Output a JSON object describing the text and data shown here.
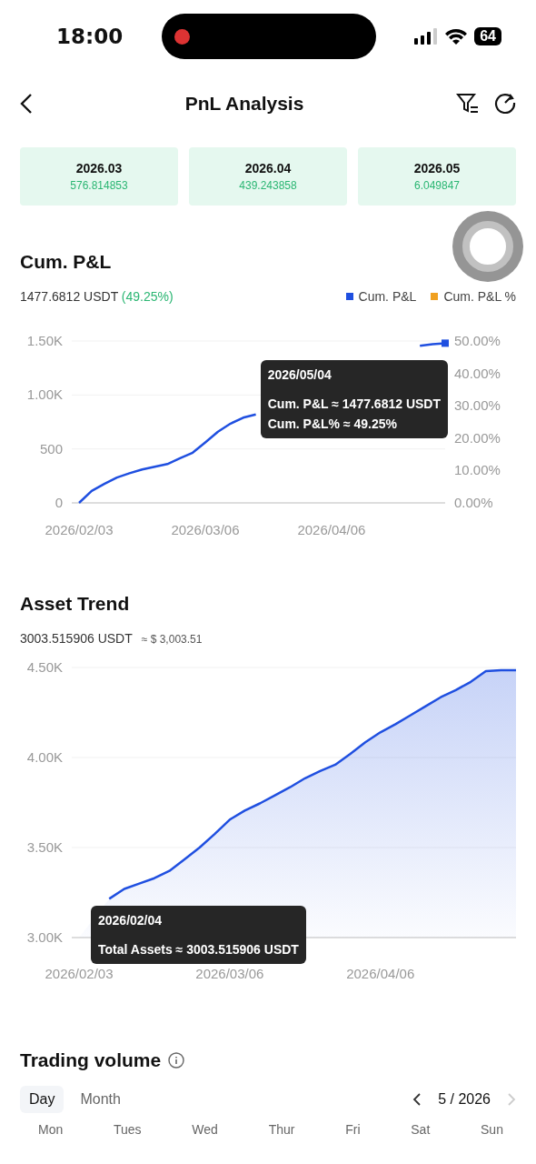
{
  "status_bar": {
    "time": "18:00",
    "battery": "64"
  },
  "nav": {
    "title": "PnL Analysis"
  },
  "months": [
    {
      "month": "2026.03",
      "value": "576.814853"
    },
    {
      "month": "2026.04",
      "value": "439.243858"
    },
    {
      "month": "2026.05",
      "value": "6.049847"
    }
  ],
  "cum_pnl": {
    "title": "Cum. P&L",
    "amount": "1477.6812 USDT",
    "percent": "(49.25%)",
    "legend": [
      {
        "label": "Cum. P&L",
        "color": "#1f4fe0"
      },
      {
        "label": "Cum. P&L %",
        "color": "#f0a020"
      }
    ],
    "right_axis_ticks": [
      "50.00%",
      "40.00%",
      "30.00%",
      "20.00%",
      "10.00%",
      "0.00%"
    ],
    "tooltip": {
      "title": "2026/05/04",
      "lines": [
        "Cum. P&L ≈ 1477.6812 USDT",
        "Cum. P&L% ≈ 49.25%"
      ]
    },
    "chart_data": {
      "type": "line",
      "categories": [
        "2026/02/03",
        null,
        null,
        null,
        null,
        null,
        null,
        null,
        null,
        null,
        "2026/03/06",
        null,
        null,
        null,
        null,
        null,
        null,
        null,
        null,
        null,
        "2026/04/06",
        null,
        null,
        null,
        null,
        null,
        null,
        null,
        null,
        null
      ],
      "series": [
        {
          "color": "#1f4fe0",
          "values": [
            0,
            110,
            175,
            235,
            275,
            310,
            335,
            360,
            415,
            465,
            560,
            660,
            735,
            790,
            820,
            null,
            null,
            null,
            null,
            null,
            null,
            null,
            null,
            null,
            null,
            null,
            null,
            1455,
            1470,
            1480
          ]
        }
      ],
      "ylim": [
        0,
        1500
      ],
      "yticks": [
        {
          "value": 0,
          "label": "0"
        },
        {
          "value": 500,
          "label": "500"
        },
        {
          "value": 1000,
          "label": "1.00K"
        },
        {
          "value": 1500,
          "label": "1.50K"
        }
      ]
    }
  },
  "asset_trend": {
    "title": "Asset Trend",
    "amount": "3003.515906 USDT",
    "approx": "≈ $ 3,003.51",
    "tooltip": {
      "title": "2026/02/04",
      "lines": [
        "Total Assets ≈ 3003.515906 USDT"
      ]
    },
    "chart_data": {
      "type": "area",
      "categories": [
        "2026/02/03",
        null,
        null,
        null,
        null,
        null,
        null,
        null,
        null,
        null,
        "2026/03/06",
        null,
        null,
        null,
        null,
        null,
        null,
        null,
        null,
        null,
        "2026/04/06",
        null,
        null,
        null,
        null,
        null,
        null,
        null,
        null,
        null
      ],
      "series": [
        {
          "color": "#1f4fe0",
          "values": [
            3000,
            null,
            3215,
            3270,
            3300,
            3330,
            3370,
            3435,
            3500,
            3575,
            3655,
            3705,
            3745,
            3790,
            3835,
            3885,
            3925,
            3960,
            4020,
            4085,
            4140,
            4185,
            4235,
            4285,
            4335,
            4375,
            4420,
            4480,
            4485,
            4485
          ]
        }
      ],
      "ylim": [
        3000,
        4500
      ],
      "yticks": [
        {
          "value": 3000,
          "label": "3.00K"
        },
        {
          "value": 3500,
          "label": "3.50K"
        },
        {
          "value": 4000,
          "label": "4.00K"
        },
        {
          "value": 4500,
          "label": "4.50K"
        }
      ]
    }
  },
  "trading_volume": {
    "title": "Trading volume",
    "tabs": [
      {
        "label": "Day",
        "selected": true
      },
      {
        "label": "Month",
        "selected": false
      }
    ],
    "period": "5 / 2026",
    "next_disabled": true,
    "weekdays": [
      "Mon",
      "Tues",
      "Wed",
      "Thur",
      "Fri",
      "Sat",
      "Sun"
    ]
  }
}
